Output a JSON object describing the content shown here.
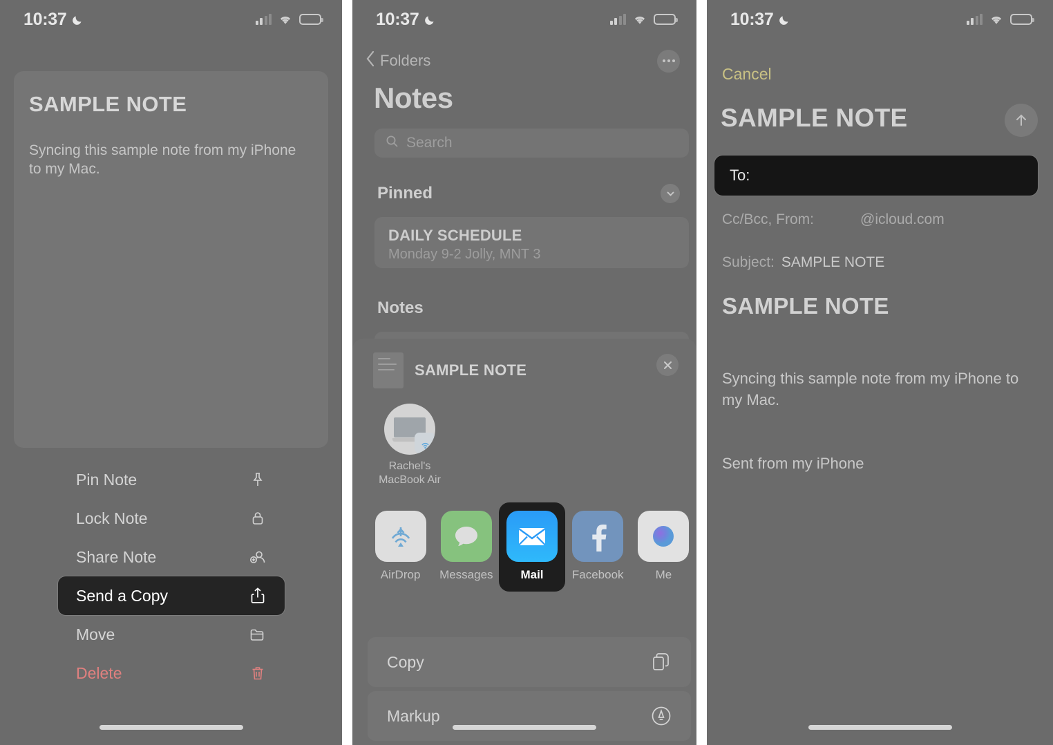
{
  "status_bar": {
    "time": "10:37",
    "moon_icon": "crescent-moon-icon",
    "signal_icon": "cellular-signal-icon",
    "wifi_icon": "wifi-icon",
    "battery_icon": "battery-low-icon"
  },
  "panel1": {
    "note": {
      "title": "SAMPLE NOTE",
      "body": "Syncing this sample note from my iPhone to my Mac."
    },
    "context_menu": [
      {
        "label": "Pin Note",
        "icon": "pin-icon",
        "state": "normal"
      },
      {
        "label": "Lock Note",
        "icon": "lock-icon",
        "state": "normal"
      },
      {
        "label": "Share Note",
        "icon": "person-add-icon",
        "state": "normal"
      },
      {
        "label": "Send a Copy",
        "icon": "share-icon",
        "state": "highlighted"
      },
      {
        "label": "Move",
        "icon": "folder-icon",
        "state": "normal"
      },
      {
        "label": "Delete",
        "icon": "trash-icon",
        "state": "danger"
      }
    ]
  },
  "panel2": {
    "nav": {
      "back_label": "Folders",
      "back_icon": "chevron-left-icon",
      "more_icon": "ellipsis-circle-icon"
    },
    "title": "Notes",
    "search": {
      "placeholder": "Search",
      "icon": "search-icon"
    },
    "sections": {
      "pinned_label": "Pinned",
      "pinned_collapse_icon": "chevron-down-circle-icon",
      "notes_label": "Notes"
    },
    "pinned_note": {
      "title": "DAILY SCHEDULE",
      "subtitle": "Monday  9-2 Jolly, MNT 3"
    },
    "share_sheet": {
      "doc_title": "SAMPLE NOTE",
      "thumb_icon": "note-thumbnail-icon",
      "close_icon": "close-icon",
      "airdrop_target": {
        "name": "Rachel's\nMacBook Air",
        "name_line1": "Rachel's",
        "name_line2": "MacBook Air",
        "icon": "macbook-airdrop-icon"
      },
      "apps": [
        {
          "label": "AirDrop",
          "icon": "airdrop-icon",
          "selected": false
        },
        {
          "label": "Messages",
          "icon": "messages-icon",
          "selected": false
        },
        {
          "label": "Mail",
          "icon": "mail-icon",
          "selected": true
        },
        {
          "label": "Facebook",
          "icon": "facebook-icon",
          "selected": false
        },
        {
          "label": "Me",
          "icon": "more-apps-icon",
          "selected": false
        }
      ],
      "actions": [
        {
          "label": "Copy",
          "icon": "copy-icon"
        },
        {
          "label": "Markup",
          "icon": "markup-pen-icon"
        }
      ]
    }
  },
  "panel3": {
    "cancel_label": "Cancel",
    "title": "SAMPLE NOTE",
    "send_icon": "send-arrow-up-icon",
    "to_label": "To:",
    "ccbcc_label": "Cc/Bcc, From:",
    "from_value": "@icloud.com",
    "subject_label": "Subject:",
    "subject_value": "SAMPLE NOTE",
    "body_title": "SAMPLE NOTE",
    "body_text": "Syncing this sample note from my iPhone to my Mac.",
    "signature": "Sent from my iPhone"
  },
  "colors": {
    "overlay_gray": "#6b6b6b",
    "card_gray": "#757575",
    "highlight_black": "#1e1e1e",
    "cancel_yellow": "#c9c184",
    "delete_red": "#e0807f",
    "mail_blue": "#2a9bf7",
    "battery_yellow": "#e4e13f"
  }
}
